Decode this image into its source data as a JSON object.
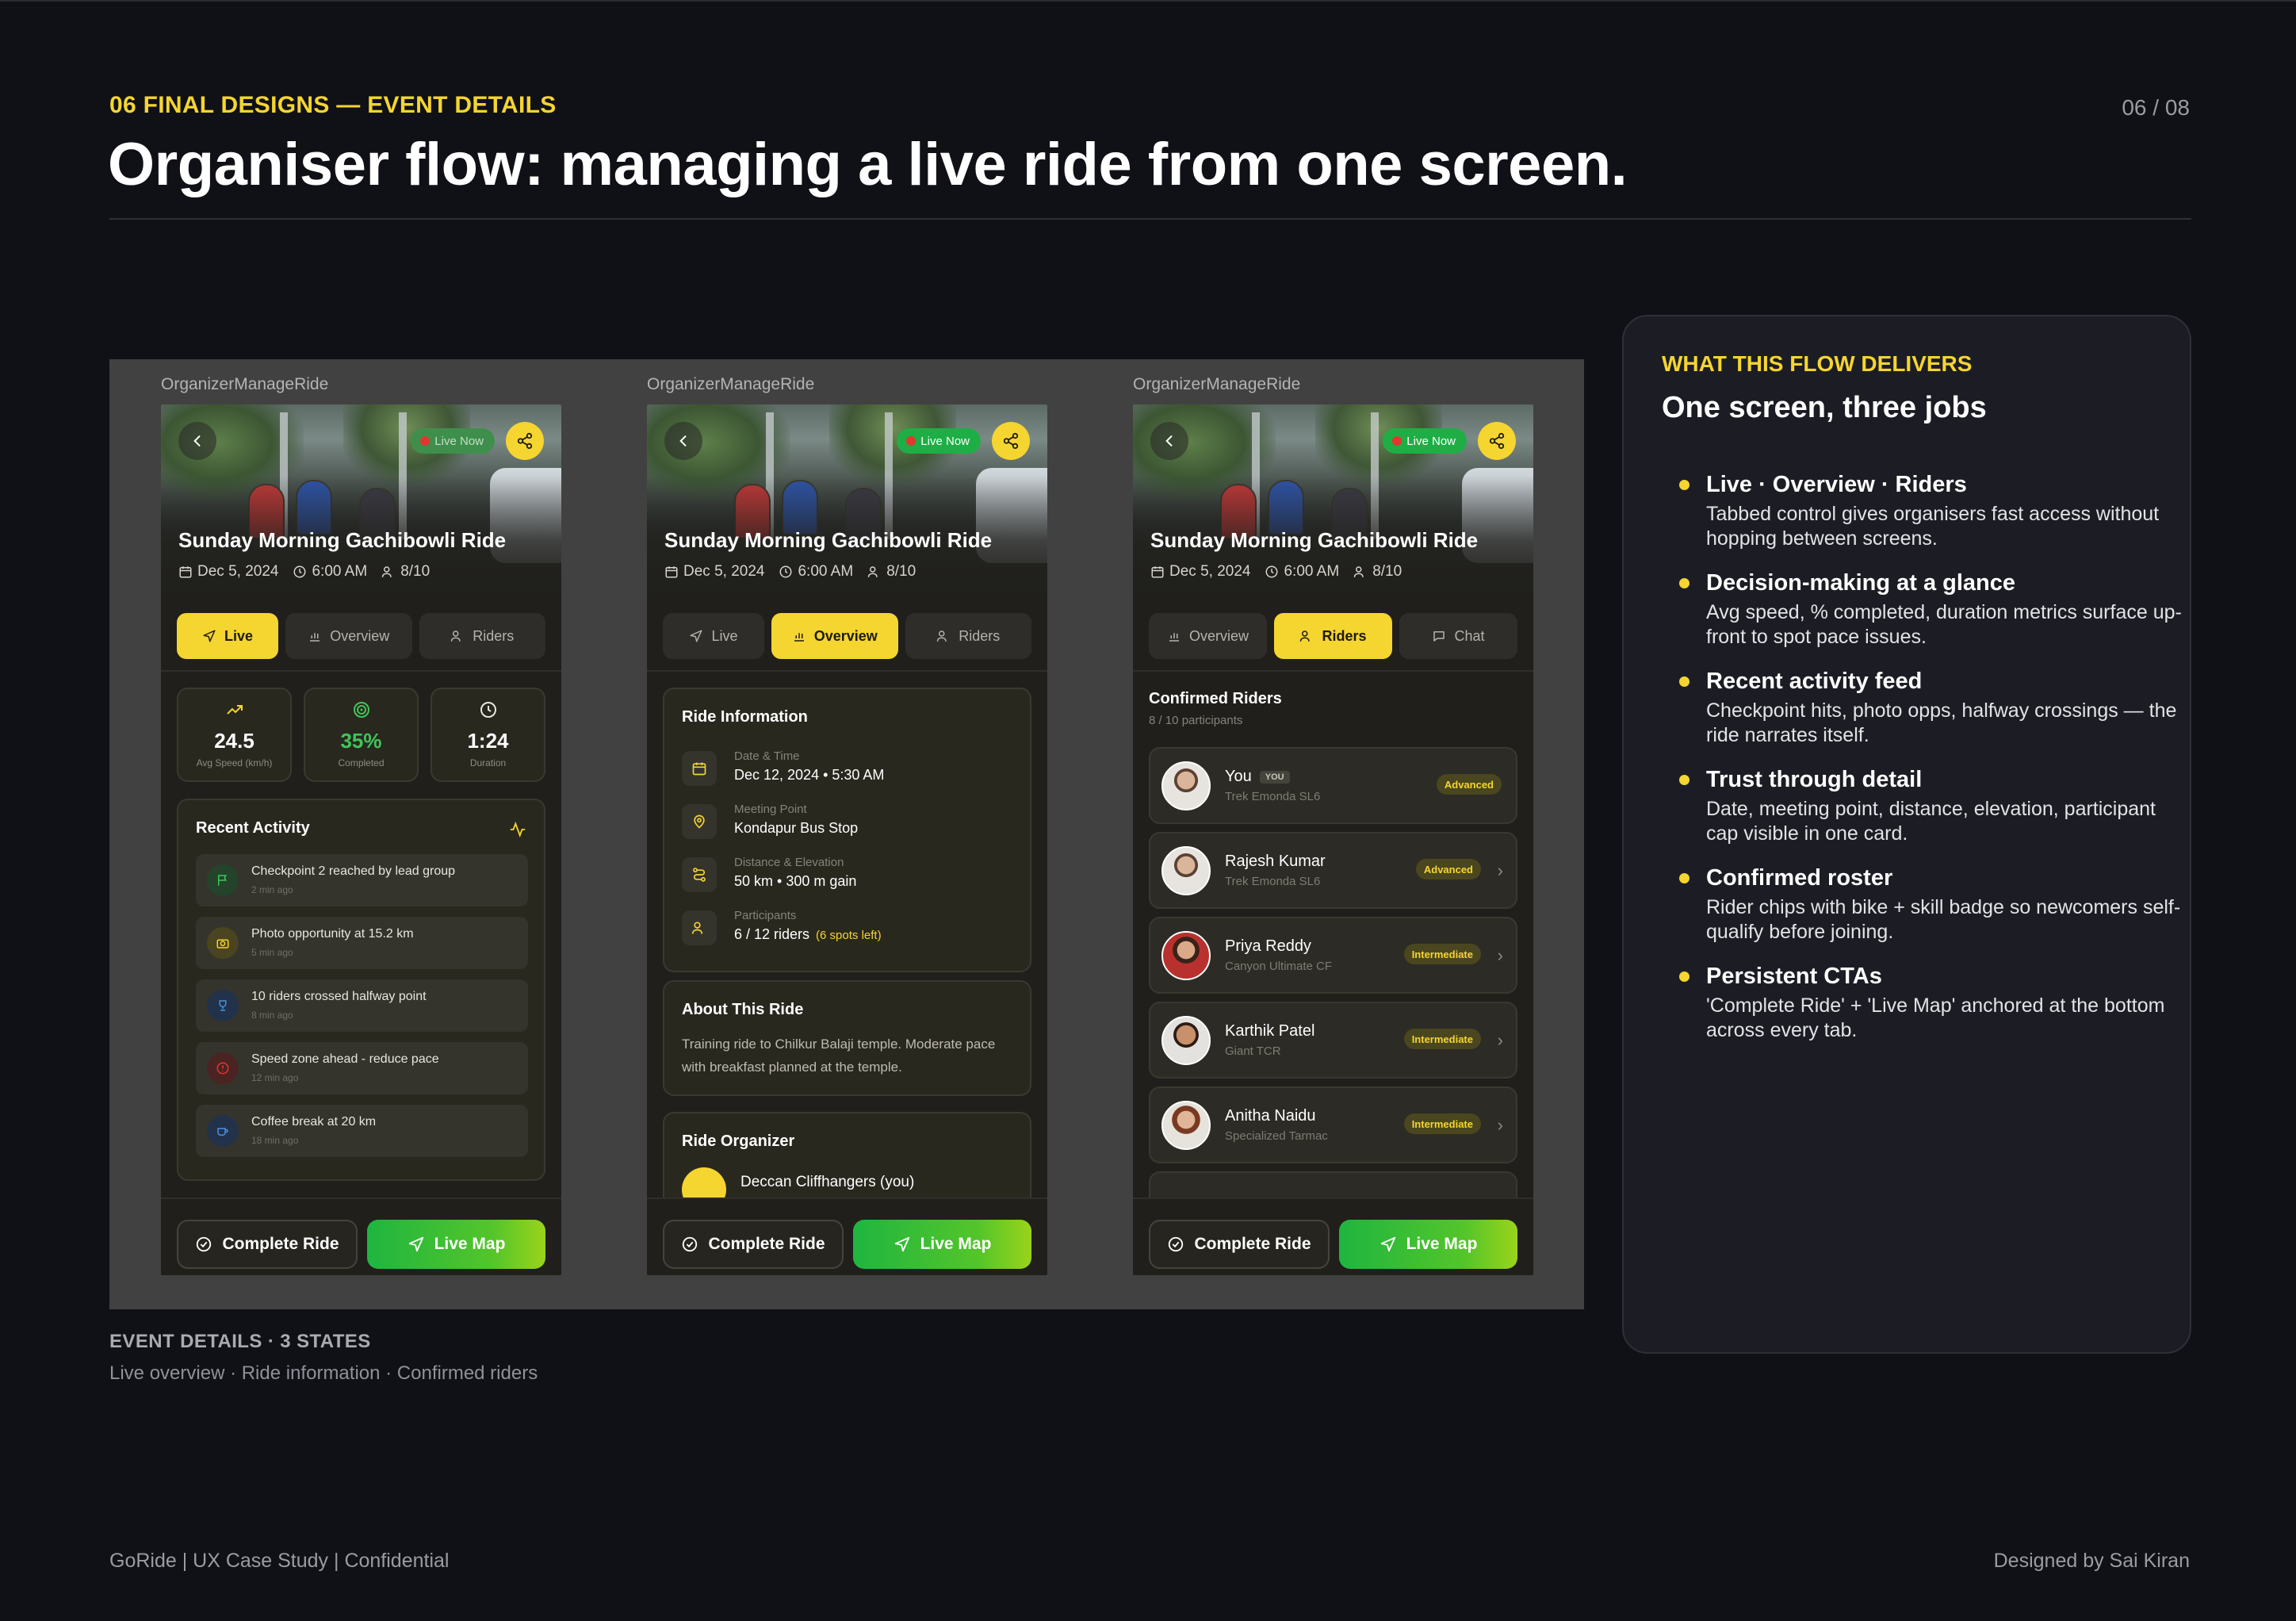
{
  "header": {
    "eyebrow": "06  FINAL DESIGNS — EVENT DETAILS",
    "page_number": "06 / 08",
    "title": "Organiser flow: managing a live ride from one screen."
  },
  "screens": [
    {
      "label": "OrganizerManageRide",
      "live_label": "Live Now",
      "ride_title": "Sunday Morning Gachibowli Ride",
      "date": "Dec 5, 2024",
      "time": "6:00 AM",
      "riders": "8/10",
      "tabs": [
        "Live",
        "Overview",
        "Riders"
      ],
      "active_tab": "Live",
      "stats": [
        {
          "value": "24.5",
          "label": "Avg Speed (km/h)"
        },
        {
          "value": "35%",
          "label": "Completed"
        },
        {
          "value": "1:24",
          "label": "Duration"
        }
      ],
      "activity_title": "Recent Activity",
      "activity": [
        {
          "text": "Checkpoint 2 reached by lead group",
          "time": "2 min ago",
          "icon": "flag-icon",
          "color": "#3fc55a"
        },
        {
          "text": "Photo opportunity at 15.2 km",
          "time": "5 min ago",
          "icon": "camera-icon",
          "color": "#f5d530"
        },
        {
          "text": "10 riders crossed halfway point",
          "time": "8 min ago",
          "icon": "trophy-icon",
          "color": "#4a90e2"
        },
        {
          "text": "Speed zone ahead - reduce pace",
          "time": "12 min ago",
          "icon": "alert-icon",
          "color": "#e2362f"
        },
        {
          "text": "Coffee break at 20 km",
          "time": "18 min ago",
          "icon": "coffee-icon",
          "color": "#4a90e2"
        }
      ],
      "complete_label": "Complete Ride",
      "map_label": "Live Map"
    },
    {
      "label": "OrganizerManageRide",
      "live_label": "Live Now",
      "ride_title": "Sunday Morning Gachibowli Ride",
      "date": "Dec 5, 2024",
      "time": "6:00 AM",
      "riders": "8/10",
      "tabs": [
        "Live",
        "Overview",
        "Riders"
      ],
      "active_tab": "Overview",
      "info_title": "Ride Information",
      "info": [
        {
          "key": "Date & Time",
          "value": "Dec 12, 2024 • 5:30 AM",
          "icon": "calendar-icon"
        },
        {
          "key": "Meeting Point",
          "value": "Kondapur Bus Stop",
          "icon": "pin-icon"
        },
        {
          "key": "Distance & Elevation",
          "value": "50 km • 300 m gain",
          "icon": "route-icon"
        },
        {
          "key": "Participants",
          "value": "6 / 12 riders",
          "extra": "(6 spots left)",
          "icon": "users-icon"
        }
      ],
      "about_title": "About This Ride",
      "about_text": "Training ride to Chilkur Balaji temple. Moderate pace with breakfast planned at the temple.",
      "organizer_title": "Ride Organizer",
      "organizer_name": "Deccan Cliffhangers (you)",
      "complete_label": "Complete Ride",
      "map_label": "Live Map"
    },
    {
      "label": "OrganizerManageRide",
      "live_label": "Live Now",
      "ride_title": "Sunday Morning Gachibowli Ride",
      "date": "Dec 5, 2024",
      "time": "6:00 AM",
      "riders": "8/10",
      "tabs": [
        "Overview",
        "Riders",
        "Chat"
      ],
      "active_tab": "Riders",
      "roster_title": "Confirmed Riders",
      "roster_count": "8 / 10 participants",
      "roster": [
        {
          "name": "You",
          "tag": "YOU",
          "bike": "Trek Emonda SL6",
          "level": "Advanced"
        },
        {
          "name": "Rajesh Kumar",
          "bike": "Trek Emonda SL6",
          "level": "Advanced"
        },
        {
          "name": "Priya Reddy",
          "bike": "Canyon Ultimate CF",
          "level": "Intermediate"
        },
        {
          "name": "Karthik Patel",
          "bike": "Giant TCR",
          "level": "Intermediate"
        },
        {
          "name": "Anitha Naidu",
          "bike": "Specialized Tarmac",
          "level": "Intermediate"
        }
      ],
      "complete_label": "Complete Ride",
      "map_label": "Live Map"
    }
  ],
  "caption": {
    "title": "EVENT DETAILS  ·  3 STATES",
    "sub": "Live overview  ·  Ride information  ·  Confirmed riders"
  },
  "side": {
    "eyebrow": "WHAT THIS FLOW DELIVERS",
    "heading": "One screen, three jobs",
    "bullets": [
      {
        "title": "Live · Overview · Riders",
        "text": "Tabbed control gives organisers fast access without hopping between screens."
      },
      {
        "title": "Decision-making at a glance",
        "text": "Avg speed, % completed, duration metrics surface up-front to spot pace issues."
      },
      {
        "title": "Recent activity feed",
        "text": "Checkpoint hits, photo opps, halfway crossings — the ride narrates itself."
      },
      {
        "title": "Trust through detail",
        "text": "Date, meeting point, distance, elevation, participant cap visible in one card."
      },
      {
        "title": "Confirmed roster",
        "text": "Rider chips with bike + skill badge so newcomers self-qualify before joining."
      },
      {
        "title": "Persistent CTAs",
        "text": "'Complete Ride' + 'Live Map' anchored at the bottom across every tab."
      }
    ]
  },
  "footer": {
    "left": "GoRide  |  UX Case Study  |  Confidential",
    "right": "Designed by Sai Kiran"
  },
  "colors": {
    "accent": "#f5d530",
    "live_green": "#1fae45",
    "background": "#101117"
  }
}
